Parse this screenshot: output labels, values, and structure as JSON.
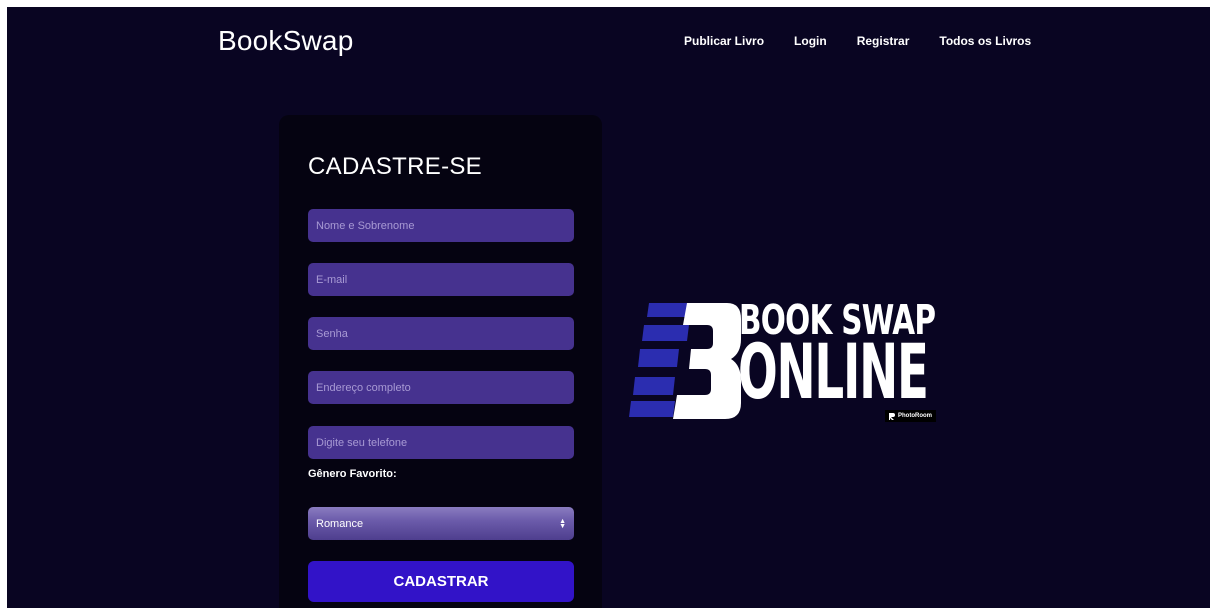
{
  "header": {
    "brand": "BookSwap",
    "nav": [
      "Publicar Livro",
      "Login",
      "Registrar",
      "Todos os Livros"
    ]
  },
  "form": {
    "title": "CADASTRE-SE",
    "fields": [
      {
        "placeholder": "Nome e Sobrenome",
        "value": ""
      },
      {
        "placeholder": "E-mail",
        "value": ""
      },
      {
        "placeholder": "Senha",
        "value": ""
      },
      {
        "placeholder": "Endereço completo",
        "value": ""
      },
      {
        "placeholder": "Digite seu telefone",
        "value": ""
      }
    ],
    "genre_label": "Gênero Favorito:",
    "genre_selected": "Romance",
    "submit_label": "CADASTRAR"
  },
  "logo": {
    "line1": "BOOK SWAP",
    "line2": "ONLINE",
    "watermark": "PhotoRoom"
  },
  "colors": {
    "background": "#090522",
    "card": "#050311",
    "input": "#46328f",
    "button": "#3213c8",
    "logo_accent": "#2b2db0"
  }
}
